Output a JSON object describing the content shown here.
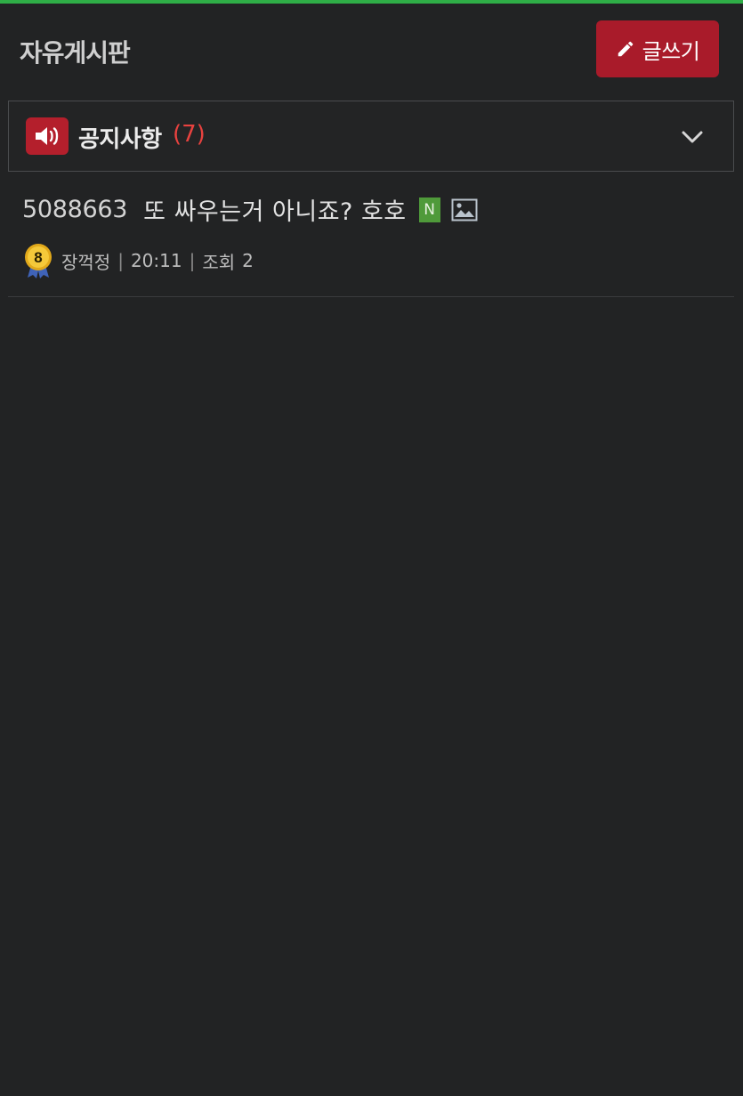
{
  "header": {
    "board_title": "자유게시판",
    "write_label": "글쓰기"
  },
  "notice": {
    "label": "공지사항",
    "count": "(7)",
    "icon": "speaker-icon",
    "expand_icon": "chevron-down-icon"
  },
  "posts": [
    {
      "id": "5088663",
      "title": "또 싸우는거 아니죠?  호호",
      "new_badge": "N",
      "has_image_icon": "image-icon",
      "level": "8",
      "author": "장꺽정",
      "time": "20:11",
      "views_label": "조회",
      "views": "2"
    }
  ],
  "colors": {
    "accent_top": "#2fae47",
    "write_button": "#a91b2a",
    "notice_count": "#e8423f",
    "new_badge": "#4f9a3a",
    "background": "#222324"
  }
}
